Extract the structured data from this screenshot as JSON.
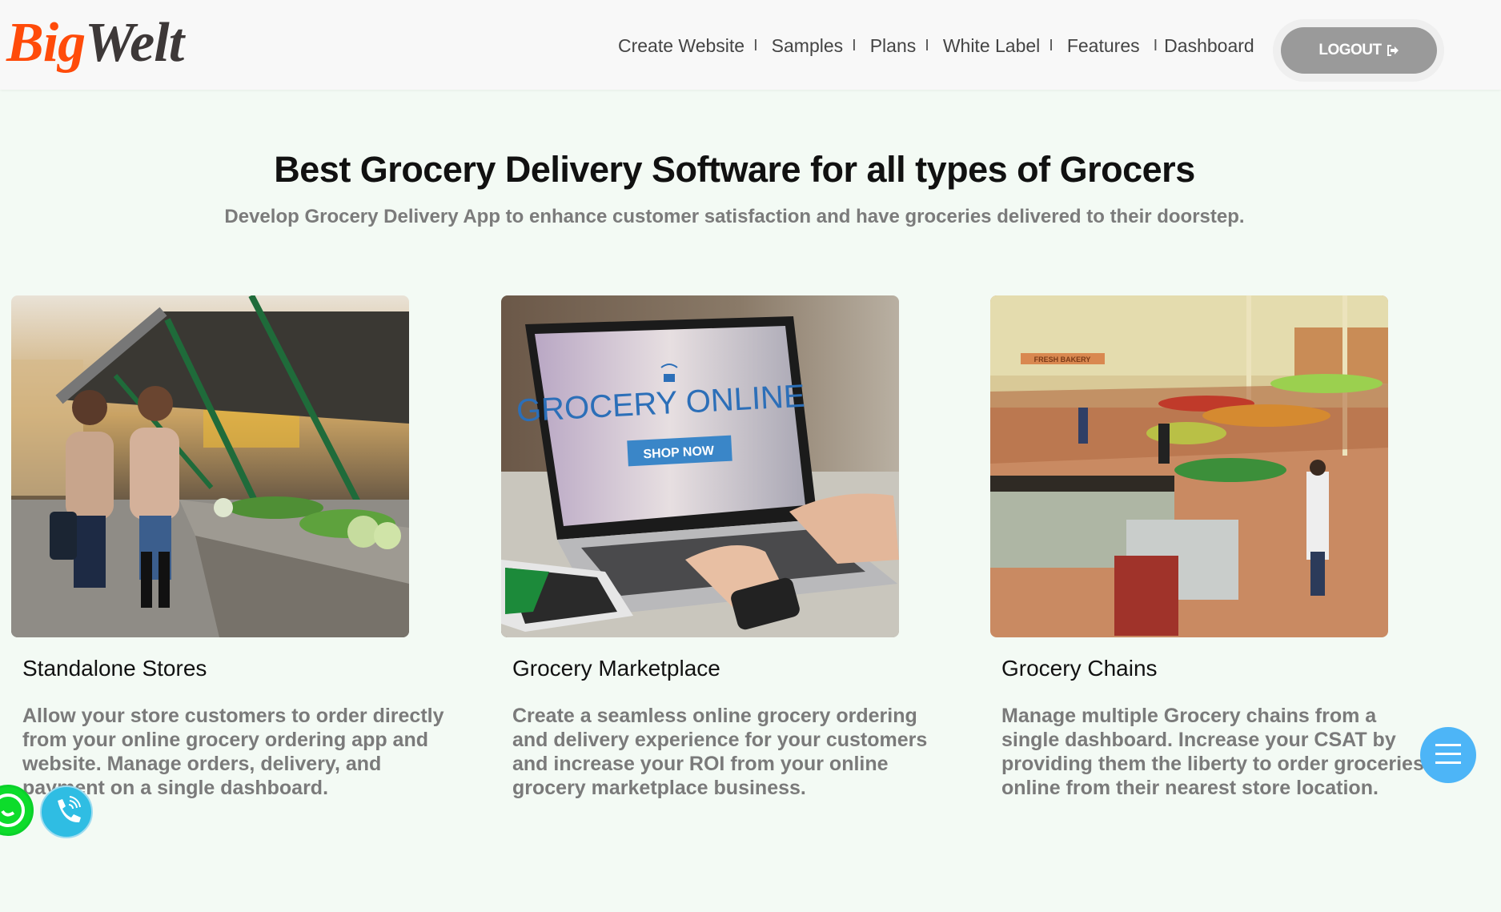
{
  "header": {
    "logo": {
      "part1": "Big",
      "part2": "Welt"
    },
    "nav": [
      {
        "label": "Create Website"
      },
      {
        "label": "Samples"
      },
      {
        "label": "Plans"
      },
      {
        "label": "White Label"
      },
      {
        "label": "Features"
      },
      {
        "label": "Dashboard"
      }
    ],
    "separator": "I",
    "logout_label": "LOGOUT",
    "logout_icon": "sign-out-icon"
  },
  "hero": {
    "title": "Best Grocery Delivery Software for all types of Grocers",
    "subtitle": "Develop Grocery Delivery App to enhance customer satisfaction and have groceries delivered to their doorstep."
  },
  "cards": [
    {
      "title": "Standalone Stores",
      "description": "Allow your store customers to order directly from your online grocery ordering app and website. Manage orders, delivery, and payment on a single dashboard.",
      "image": "photo-two-women-at-outdoor-vegetable-market"
    },
    {
      "title": "Grocery Marketplace",
      "description": "Create a seamless online grocery ordering and delivery experience for your customers and increase your ROI from your online grocery marketplace business.",
      "image": "photo-laptop-grocery-online",
      "image_text": {
        "headline": "GROCERY ONLINE",
        "button": "SHOP NOW"
      }
    },
    {
      "title": "Grocery Chains",
      "description": "Manage multiple Grocery chains from a single dashboard. Increase your CSAT by providing them the liberty to order groceries online from their nearest store location.",
      "image": "photo-supermarket-interior",
      "image_text": {
        "sign": "FRESH BAKERY"
      }
    }
  ],
  "floating": {
    "whatsapp": "whatsapp-icon",
    "phone": "phone-icon",
    "menu": "hamburger-menu-icon"
  },
  "colors": {
    "brand_orange": "#ff4b0a",
    "brand_dark": "#3d3838",
    "page_bg": "#f3faf4",
    "header_bg": "#f8f8f8",
    "logout_bg": "#9a9a9a",
    "menu_fab": "#4db5f7",
    "phone_fab": "#2fbde3",
    "whatsapp_fab": "#0ddc2b"
  }
}
